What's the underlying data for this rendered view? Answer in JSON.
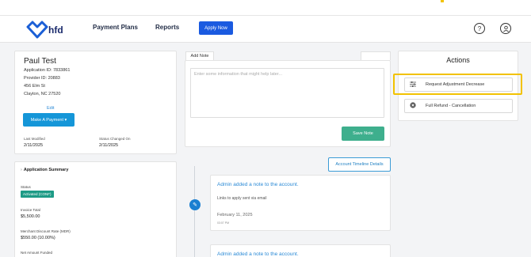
{
  "nav": {
    "logo_text": "hfd",
    "links": [
      "Payment Plans",
      "Reports"
    ],
    "apply_button": "Apply Now",
    "help_icon": "help-icon",
    "profile_icon": "user-icon"
  },
  "customer": {
    "name": "Paul Test",
    "application_id": "Application ID: 7833861",
    "provider_id": "Provider ID: 20883",
    "address_line1": "456 Elm St",
    "address_line2": "Clayton, NC 27520",
    "edit_label": "Edit",
    "make_payment_label": "Make A Payment ▾",
    "last_modified_label": "Last Modified",
    "last_modified_value": "2/11/2025",
    "status_changed_label": "Status Changed On",
    "status_changed_value": "2/11/2025"
  },
  "summary": {
    "title": "Application Summary",
    "status_label": "Status",
    "status_value": "Activated (CONF)",
    "invoice_label": "Invoice Total",
    "invoice_value": "$5,500.00",
    "mdr_label": "Merchant Discount Rate (MDR)",
    "mdr_value": "$550.00 (10.00%)",
    "net_label": "Net Amount Funded"
  },
  "note": {
    "tab_label": "Add Note",
    "placeholder": "Enter some information that might help later...",
    "save_label": "Save Note"
  },
  "timeline": {
    "details_button": "Account Timeline Details",
    "entries": [
      {
        "title": "Admin added a note to the account.",
        "subtitle": "Links to apply sent via email",
        "date": "February 11, 2025",
        "time": "03:07 PM"
      },
      {
        "title": "Admin added a note to the account."
      }
    ]
  },
  "actions": {
    "title": "Actions",
    "items": [
      {
        "label": "Request Adjustment Decrease",
        "icon": "sliders-icon"
      },
      {
        "label": "Full Refund - Cancellation",
        "icon": "cancel-circle-icon"
      }
    ]
  },
  "colors": {
    "primary": "#1596d8",
    "apply": "#1a5ae0",
    "save": "#3eaf8d",
    "status": "#1e9b86",
    "highlight": "#f2c200",
    "link": "#2b8ad6"
  }
}
